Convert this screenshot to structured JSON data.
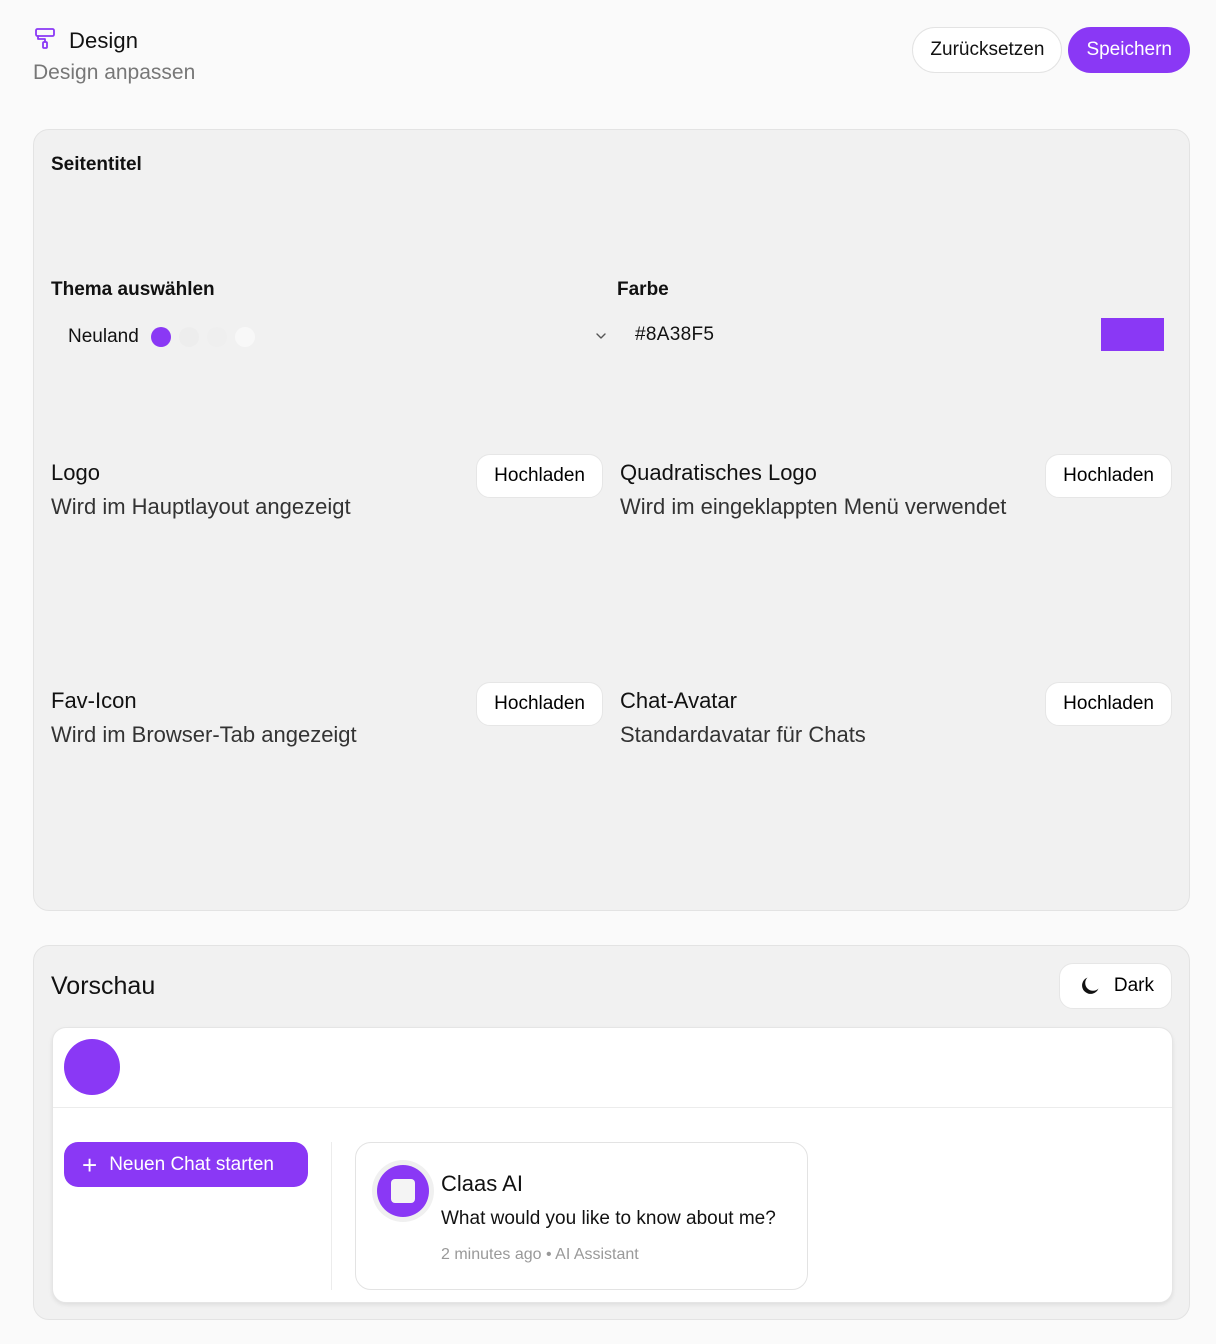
{
  "header": {
    "title": "Design",
    "subtitle": "Design anpassen",
    "reset_label": "Zurücksetzen",
    "save_label": "Speichern"
  },
  "settings": {
    "site_title_label": "Seitentitel",
    "theme": {
      "label": "Thema auswählen",
      "selected": "Neuland",
      "swatches": [
        "#8A38F5",
        "#EDEDED",
        "#EFEFEF",
        "#F8F8F8"
      ]
    },
    "color": {
      "label": "Farbe",
      "value": "#8A38F5"
    },
    "uploads": [
      {
        "title": "Logo",
        "description": "Wird im Hauptlayout angezeigt",
        "button": "Hochladen"
      },
      {
        "title": "Quadratisches Logo",
        "description": "Wird im eingeklappten Menü verwendet",
        "button": "Hochladen"
      },
      {
        "title": "Fav-Icon",
        "description": "Wird im Browser-Tab angezeigt",
        "button": "Hochladen"
      },
      {
        "title": "Chat-Avatar",
        "description": "Standardavatar für Chats",
        "button": "Hochladen"
      }
    ]
  },
  "preview": {
    "title": "Vorschau",
    "mode_label": "Dark",
    "new_chat_label": "Neuen Chat starten",
    "chat": {
      "name": "Claas AI",
      "message": "What would you like to know about me?",
      "time": "2 minutes ago",
      "separator": "•",
      "role": "AI Assistant"
    }
  },
  "colors": {
    "accent": "#8A38F5",
    "card_background": "#F1F1F1",
    "page_background": "#FAFAFA"
  },
  "icons": {
    "title": "paint-roller-icon",
    "theme_dropdown": "chevron-down-icon",
    "mode": "moon-icon",
    "new_chat": "plus-icon"
  }
}
